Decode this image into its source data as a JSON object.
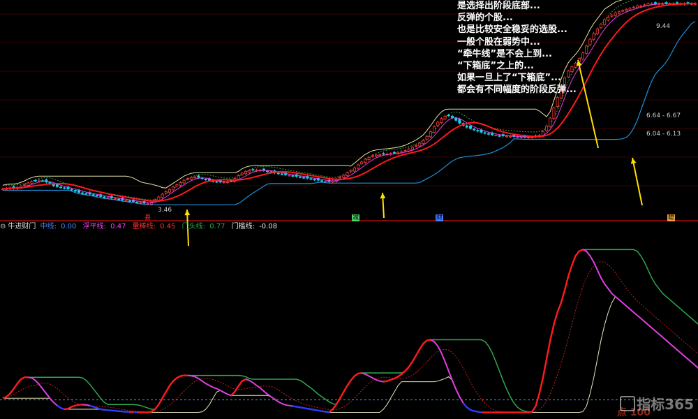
{
  "annotation_lines": [
    "是选择出阶段底部...",
    "反弹的个股...",
    "也是比较安全稳妥的选股...",
    "一般个股在弱势中...",
    "“牵牛线”是不会上到...",
    "“下箱底”之上的...",
    "如果一旦上了“下箱底”...",
    "都会有不同幅度的阶段反弹..."
  ],
  "indicator": {
    "name": "牛进财门",
    "items": [
      {
        "label": "中线:",
        "value": "0.00",
        "color": "#3d8bff"
      },
      {
        "label": "浮平线:",
        "value": "0.47",
        "color": "#ff40ff"
      },
      {
        "label": "量棒线:",
        "value": "0.45",
        "color": "#ff3030"
      },
      {
        "label": "门头线:",
        "value": "0.77",
        "color": "#2ea84a"
      },
      {
        "label": "门槛线:",
        "value": "-0.08",
        "color": "#e8e8e8"
      }
    ]
  },
  "signal_tags": [
    {
      "text": "县",
      "color": "#ff3030"
    },
    {
      "text": "减",
      "color": "#4fd36a"
    },
    {
      "text": "财",
      "color": "#4a7fff"
    },
    {
      "text": "聪",
      "color": "#e8a040"
    }
  ],
  "price_labels": {
    "low": "3.46",
    "high": "9.44",
    "box_upper": "6.64 - 6.67",
    "box_lower": "6.04 - 6.13"
  },
  "watermark": {
    "brand": "指标365",
    "sub": "点 100"
  },
  "colors": {
    "up": "#ff3b3b",
    "down": "#19d3f0",
    "ma_red": "#ff1a1a",
    "ma_magenta": "#e040e0",
    "box_upper": "#e8e8a8",
    "box_lower": "#1f8fd8",
    "envelope": "#2fa84a",
    "arrow": "#ffe000",
    "divider": "#d01010"
  },
  "chart_data": [
    {
      "type": "candlestick",
      "title": "",
      "x": [
        0,
        1,
        2,
        3,
        4,
        5,
        6,
        7,
        8,
        9,
        10,
        11,
        12,
        13,
        14,
        15,
        16,
        17,
        18,
        19,
        20,
        21,
        22,
        23,
        24,
        25,
        26,
        27,
        28,
        29,
        30,
        31,
        32,
        33,
        34,
        35,
        36,
        37,
        38,
        39,
        40,
        41,
        42,
        43,
        44,
        45,
        46,
        47,
        48,
        49,
        50,
        51,
        52,
        53,
        54,
        55,
        56,
        57,
        58,
        59,
        60,
        61,
        62,
        63,
        64,
        65,
        66,
        67,
        68,
        69,
        70,
        71,
        72,
        73,
        74,
        75,
        76,
        77,
        78,
        79,
        80,
        81,
        82,
        83,
        84,
        85,
        86,
        87,
        88,
        89,
        90,
        91,
        92,
        93,
        94,
        95,
        96,
        97,
        98,
        99,
        100,
        101,
        102,
        103,
        104,
        105,
        106,
        107,
        108,
        109,
        110,
        111,
        112,
        113,
        114,
        115,
        116,
        117,
        118,
        119,
        120,
        121,
        122,
        123,
        124,
        125,
        126,
        127,
        128,
        129,
        130,
        131,
        132,
        133,
        134,
        135,
        136,
        137,
        138,
        139,
        140,
        141,
        142,
        143,
        144,
        145,
        146,
        147,
        148,
        149,
        150,
        151,
        152,
        153,
        154,
        155,
        156,
        157,
        158,
        159,
        160,
        161,
        162,
        163,
        164,
        165,
        166,
        167,
        168,
        169,
        170,
        171,
        172,
        173,
        174,
        175,
        176,
        177,
        178,
        179,
        180,
        181,
        182,
        183,
        184,
        185,
        186,
        187,
        188,
        189,
        190,
        191,
        192,
        193,
        194,
        195,
        196,
        197,
        198,
        199
      ],
      "close": [
        4.1,
        4.13,
        4.15,
        4.13,
        4.17,
        4.22,
        4.28,
        4.36,
        4.42,
        4.46,
        4.48,
        4.45,
        4.4,
        4.32,
        4.24,
        4.2,
        4.17,
        4.14,
        4.1,
        4.06,
        4.0,
        3.95,
        3.92,
        3.89,
        3.87,
        3.84,
        3.8,
        3.77,
        3.74,
        3.72,
        3.7,
        3.68,
        3.65,
        3.62,
        3.6,
        3.57,
        3.55,
        3.52,
        3.5,
        3.48,
        3.46,
        3.52,
        3.62,
        3.75,
        3.87,
        3.98,
        4.08,
        4.18,
        4.28,
        4.38,
        4.48,
        4.55,
        4.6,
        4.62,
        4.6,
        4.55,
        4.5,
        4.47,
        4.44,
        4.42,
        4.4,
        4.4,
        4.42,
        4.45,
        4.55,
        4.68,
        4.79,
        4.86,
        4.9,
        4.92,
        4.93,
        4.92,
        4.9,
        4.87,
        4.84,
        4.81,
        4.78,
        4.75,
        4.72,
        4.7,
        4.68,
        4.65,
        4.62,
        4.6,
        4.57,
        4.54,
        4.51,
        4.48,
        4.46,
        4.44,
        4.42,
        4.45,
        4.53,
        4.62,
        4.7,
        4.8,
        4.9,
        5.02,
        5.15,
        5.28,
        5.4,
        5.48,
        5.55,
        5.58,
        5.6,
        5.62,
        5.63,
        5.65,
        5.67,
        5.7,
        5.73,
        5.78,
        5.85,
        5.92,
        6.0,
        6.1,
        6.22,
        6.4,
        6.6,
        6.82,
        7.02,
        7.18,
        7.28,
        7.3,
        7.22,
        7.1,
        6.98,
        6.88,
        6.8,
        6.74,
        6.68,
        6.63,
        6.58,
        6.54,
        6.5,
        6.47,
        6.45,
        6.43,
        6.42,
        6.41,
        6.4,
        6.39,
        6.38,
        6.37,
        6.36,
        6.36,
        6.37,
        6.39,
        6.45,
        6.6,
        6.85,
        7.2,
        7.65,
        8.1,
        8.55,
        8.95,
        9.25,
        9.44,
        9.6,
        9.8,
        10.05,
        10.35,
        10.65,
        10.9,
        11.1,
        11.3,
        11.5,
        11.6,
        11.7,
        11.8,
        11.85,
        11.9,
        11.95,
        12.0,
        12.05,
        12.1,
        12.1,
        12.15,
        12.2,
        12.2,
        12.2,
        12.2,
        12.2,
        12.2,
        12.2,
        12.2,
        12.2,
        12.2,
        12.2,
        12.2,
        12.2,
        12.2
      ],
      "series": [
        {
          "name": "中线",
          "values": [
            0.05,
            0.1,
            0.2,
            0.35,
            0.52,
            0.66,
            0.72,
            0.72,
            0.7,
            0.62,
            0.5,
            0.35,
            0.2,
            0.05,
            -0.08,
            -0.18,
            -0.26,
            -0.3,
            -0.28,
            -0.22,
            -0.18,
            -0.16,
            -0.15,
            -0.16,
            -0.18,
            -0.22,
            -0.26,
            -0.3,
            -0.32,
            -0.33,
            -0.34,
            -0.35,
            -0.36,
            -0.37,
            -0.38,
            -0.39,
            -0.39,
            -0.4,
            -0.4,
            -0.4,
            -0.4,
            -0.38,
            -0.3,
            -0.15,
            0.05,
            0.25,
            0.45,
            0.6,
            0.7,
            0.76,
            0.78,
            0.78,
            0.77,
            0.74,
            0.68,
            0.6,
            0.52,
            0.46,
            0.4,
            0.36,
            0.3,
            0.24,
            0.18,
            0.14,
            0.26,
            0.44,
            0.6,
            0.66,
            0.62,
            0.55,
            0.46,
            0.38,
            0.28,
            0.18,
            0.1,
            0.02,
            -0.06,
            -0.12,
            -0.16,
            -0.18,
            -0.2,
            -0.22,
            -0.24,
            -0.26,
            -0.28,
            -0.3,
            -0.32,
            -0.34,
            -0.36,
            -0.38,
            -0.4,
            -0.3,
            -0.15,
            0.05,
            0.25,
            0.45,
            0.62,
            0.76,
            0.84,
            0.86,
            0.82,
            0.76,
            0.7,
            0.64,
            0.6,
            0.58,
            0.6,
            0.64,
            0.68,
            0.74,
            0.82,
            0.92,
            1.05,
            1.22,
            1.42,
            1.62,
            1.8,
            1.9,
            1.92,
            1.86,
            1.72,
            1.5,
            1.22,
            0.92,
            0.62,
            0.34,
            0.1,
            -0.1,
            -0.24,
            -0.32,
            -0.36,
            -0.38,
            -0.4,
            -0.4,
            -0.4,
            -0.4,
            -0.4,
            -0.4,
            -0.4,
            -0.4,
            -0.4,
            -0.4,
            -0.4,
            -0.4,
            -0.4,
            -0.4,
            -0.38,
            -0.2,
            0.2,
            0.7,
            1.3,
            1.9,
            2.4,
            2.8,
            3.1,
            3.5,
            3.95,
            4.3,
            4.6,
            4.75,
            4.8,
            4.75,
            4.6,
            4.4,
            4.15,
            3.9,
            3.7,
            3.55,
            3.4,
            3.3,
            3.2,
            3.1,
            3.0,
            2.9,
            2.8,
            2.7,
            2.6,
            2.5,
            2.4,
            2.3,
            2.2,
            2.1,
            2.0,
            1.9,
            1.8,
            1.7,
            1.6,
            1.5,
            1.4,
            1.3,
            1.2,
            1.1,
            1.0
          ]
        }
      ]
    },
    {
      "type": "line",
      "title": "牛进财门",
      "series": [
        {
          "name": "中线",
          "value": 0.0
        },
        {
          "name": "浮平线",
          "value": 0.47
        },
        {
          "name": "量棒线",
          "value": 0.45
        },
        {
          "name": "门头线",
          "value": 0.77
        },
        {
          "name": "门槛线",
          "value": -0.08
        }
      ]
    }
  ]
}
